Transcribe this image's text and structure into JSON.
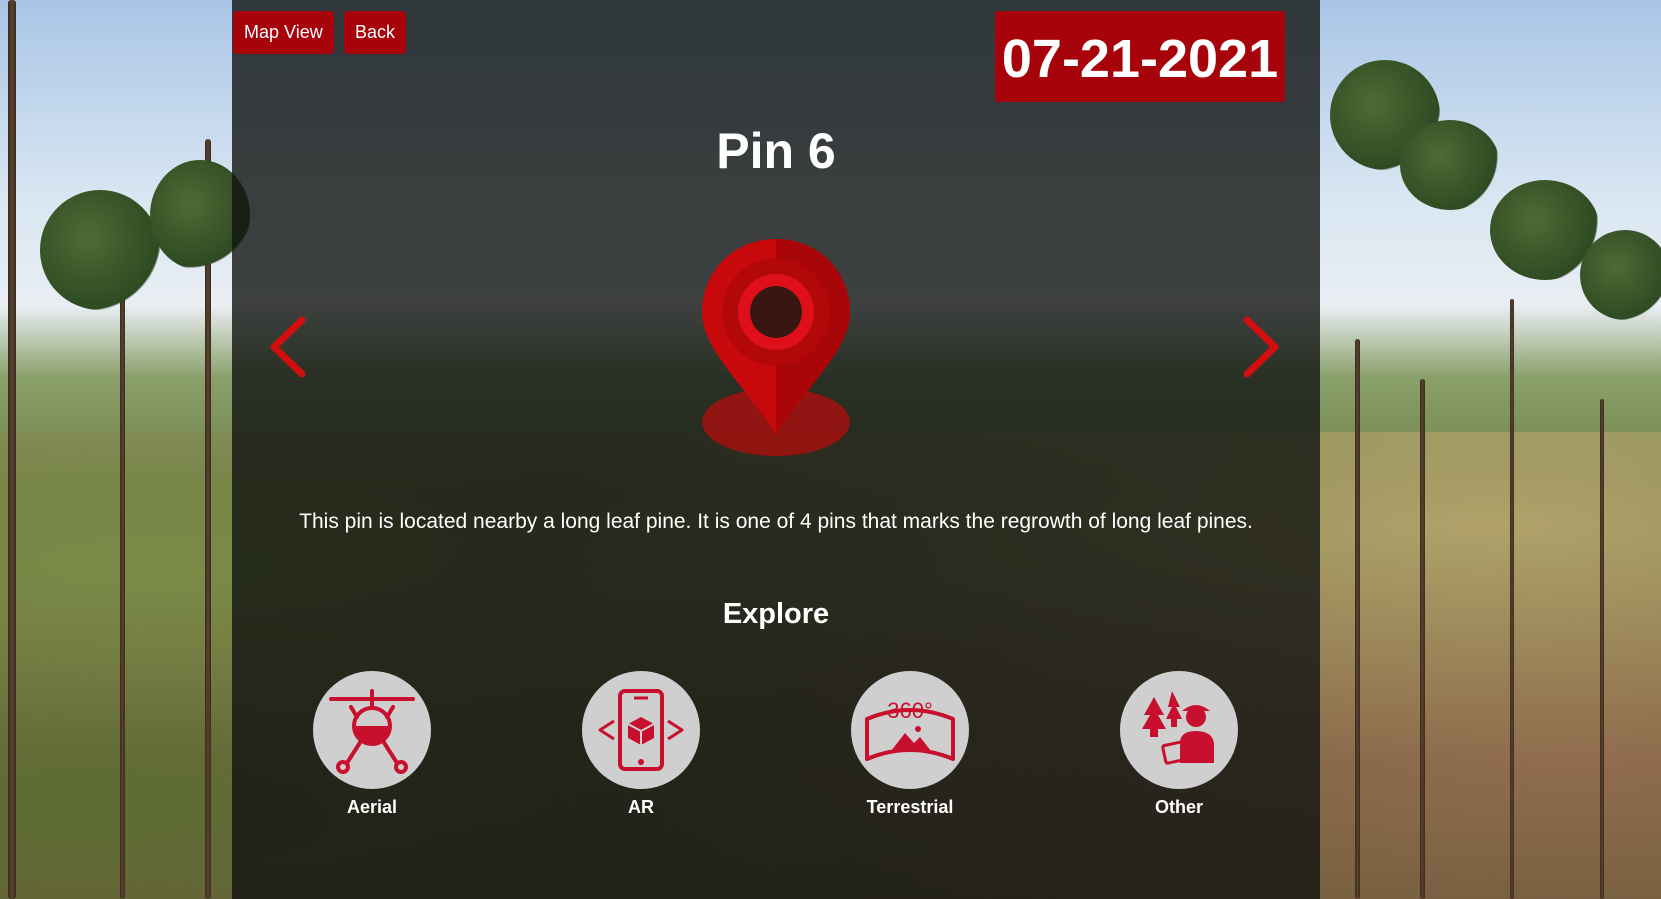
{
  "toolbar": {
    "map_view_label": "Map View",
    "back_label": "Back"
  },
  "date_badge": "07-21-2021",
  "pin": {
    "title": "Pin 6",
    "description": "This pin is located nearby a long leaf pine. It is one of 4 pins that marks the regrowth of long leaf pines.",
    "icon": "map-pin-icon"
  },
  "navigation": {
    "prev_icon": "chevron-left-icon",
    "next_icon": "chevron-right-icon"
  },
  "explore": {
    "heading": "Explore",
    "options": [
      {
        "label": "Aerial",
        "icon": "drone-icon"
      },
      {
        "label": "AR",
        "icon": "ar-phone-icon"
      },
      {
        "label": "Terrestrial",
        "icon": "360-icon"
      },
      {
        "label": "Other",
        "icon": "field-worker-icon"
      }
    ]
  },
  "colors": {
    "accent": "#a6030b",
    "pin_red": "#d20a0a",
    "icon_red": "#c8102e",
    "icon_bg": "#cfcfcf",
    "overlay": "#121412"
  }
}
